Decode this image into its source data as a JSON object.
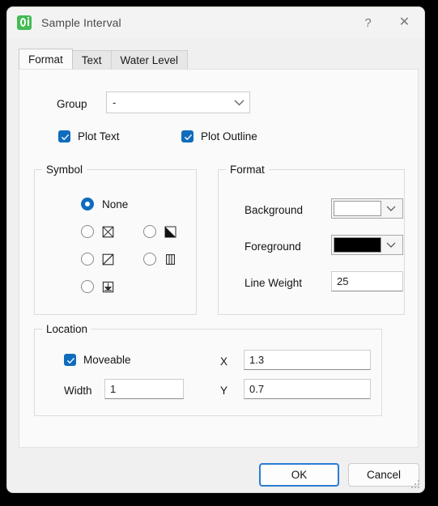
{
  "window": {
    "title": "Sample Interval",
    "icon": "app-icon",
    "help_label": "?",
    "close_label": "✕"
  },
  "tabs": [
    {
      "label": "Format",
      "active": true
    },
    {
      "label": "Text",
      "active": false
    },
    {
      "label": "Water Level",
      "active": false
    }
  ],
  "form": {
    "group": {
      "label": "Group",
      "value": "-",
      "placeholder": ""
    },
    "plot_text": {
      "label": "Plot Text",
      "checked": true
    },
    "plot_outline": {
      "label": "Plot Outline",
      "checked": true
    }
  },
  "symbol": {
    "title": "Symbol",
    "options": [
      {
        "id": "none",
        "label": "None",
        "glyph": "none",
        "checked": true
      },
      {
        "id": "boxed-x",
        "label": "",
        "glyph": "square-with-x",
        "checked": false
      },
      {
        "id": "half-filled",
        "label": "",
        "glyph": "square-diagonal-filled",
        "checked": false
      },
      {
        "id": "diagonal",
        "label": "",
        "glyph": "square-with-diagonal",
        "checked": false
      },
      {
        "id": "columns",
        "label": "",
        "glyph": "square-with-vertical-bars",
        "checked": false
      },
      {
        "id": "down-arrow",
        "label": "",
        "glyph": "square-with-down-arrow",
        "checked": false
      }
    ]
  },
  "format": {
    "title": "Format",
    "background": {
      "label": "Background",
      "color": "#ffffff"
    },
    "foreground": {
      "label": "Foreground",
      "color": "#000000"
    },
    "line_weight": {
      "label": "Line Weight",
      "value": "25"
    }
  },
  "location": {
    "title": "Location",
    "moveable": {
      "label": "Moveable",
      "checked": true
    },
    "width": {
      "label": "Width",
      "value": "1"
    },
    "x": {
      "label": "X",
      "value": "1.3"
    },
    "y": {
      "label": "Y",
      "value": "0.7"
    }
  },
  "footer": {
    "ok_label": "OK",
    "cancel_label": "Cancel"
  },
  "colors": {
    "accent": "#0f6cbd",
    "title_icon": "#44bb55",
    "default_button_border": "#2b7cd3"
  }
}
